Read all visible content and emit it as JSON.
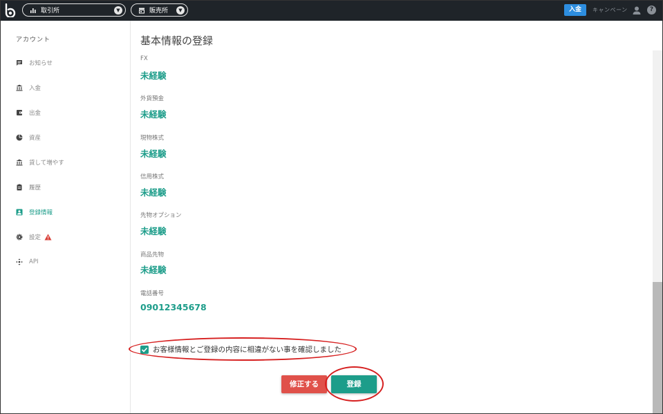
{
  "topbar": {
    "trade_label": "取引所",
    "sales_label": "販売所",
    "deposit_label": "入金",
    "campaign_label": "キャンペーン"
  },
  "sidebar": {
    "title": "アカウント",
    "items": [
      {
        "label": "お知らせ",
        "icon": "message-icon"
      },
      {
        "label": "入金",
        "icon": "bank-icon"
      },
      {
        "label": "出金",
        "icon": "wallet-icon"
      },
      {
        "label": "資産",
        "icon": "pie-chart-icon"
      },
      {
        "label": "貸して増やす",
        "icon": "bank-icon"
      },
      {
        "label": "履歴",
        "icon": "clipboard-icon"
      },
      {
        "label": "登録情報",
        "icon": "account-box-icon",
        "active": true
      },
      {
        "label": "設定",
        "icon": "gear-icon"
      },
      {
        "label": "API",
        "icon": "move-icon"
      }
    ]
  },
  "main": {
    "title": "基本情報の登録",
    "fields": [
      {
        "label": "FX",
        "value": "未経験"
      },
      {
        "label": "外貨預金",
        "value": "未経験"
      },
      {
        "label": "現物株式",
        "value": "未経験"
      },
      {
        "label": "信用株式",
        "value": "未経験"
      },
      {
        "label": "先物オプション",
        "value": "未経験"
      },
      {
        "label": "商品先物",
        "value": "未経験"
      },
      {
        "label": "電話番号",
        "value": "09012345678"
      }
    ],
    "confirm_text": "お客様情報とご登録の内容に相違がない事を確認しました",
    "confirm_checked": true,
    "edit_button": "修正する",
    "register_button": "登録"
  },
  "colors": {
    "accent": "#1d9d8a",
    "danger": "#e0514a",
    "topbar": "#1f2429",
    "deposit": "#2d8ee0"
  }
}
